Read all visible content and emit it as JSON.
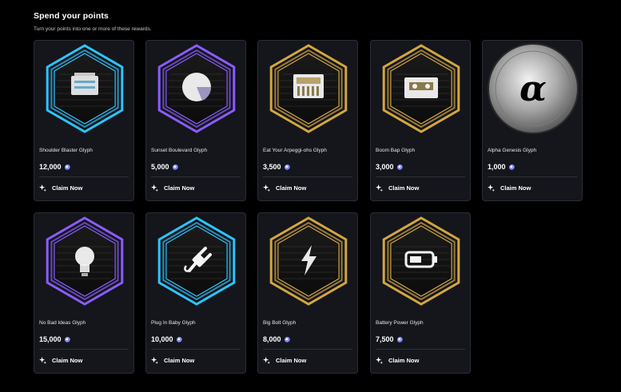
{
  "header": {
    "title": "Spend your points",
    "subtitle": "Turn your points into one or more of these rewards."
  },
  "claim_label": "Claim Now",
  "rewards": [
    {
      "name": "Shoulder Blaster Glyph",
      "price": "12,000",
      "color": "#2ec4ff",
      "icon": "boombox-icon"
    },
    {
      "name": "Sunset Boulevard Glyph",
      "price": "5,000",
      "color": "#8b5cff",
      "icon": "sun-icon"
    },
    {
      "name": "Eat Your Arpeggi-ohs Glyph",
      "price": "3,500",
      "color": "#d4a640",
      "icon": "keyboard-icon"
    },
    {
      "name": "Boom Bap Glyph",
      "price": "3,000",
      "color": "#d4a640",
      "icon": "cassette-icon"
    },
    {
      "name": "Alpha Genesis Glyph",
      "price": "1,000",
      "color": "#b8b8b8",
      "icon": "alpha-coin-icon",
      "glyph": "α"
    },
    {
      "name": "No Bad Ideas Glyph",
      "price": "15,000",
      "color": "#8b5cff",
      "icon": "lightbulb-icon"
    },
    {
      "name": "Plug In Baby Glyph",
      "price": "10,000",
      "color": "#2ec4ff",
      "icon": "plug-icon"
    },
    {
      "name": "Big Bolt Glyph",
      "price": "8,000",
      "color": "#d4a640",
      "icon": "bolt-icon"
    },
    {
      "name": "Battery Power Glyph",
      "price": "7,500",
      "color": "#d4a640",
      "icon": "battery-icon"
    }
  ]
}
